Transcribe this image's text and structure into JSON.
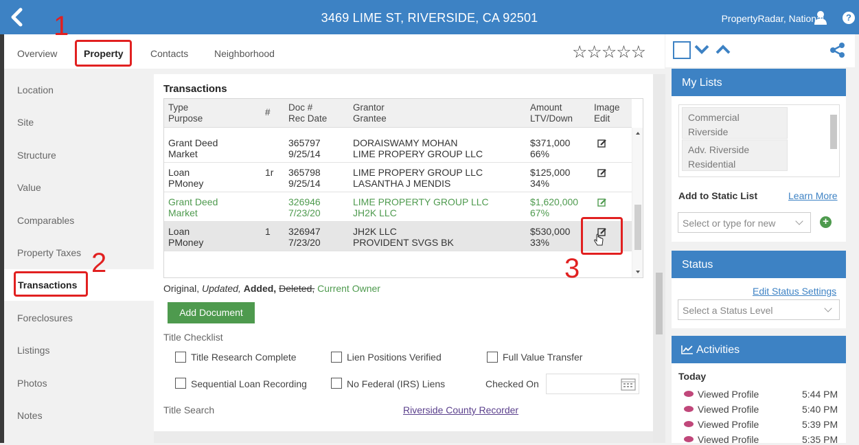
{
  "header": {
    "address": "3469 LIME ST, RIVERSIDE, CA 92501",
    "account": "PropertyRadar, National"
  },
  "tabs": [
    "Overview",
    "Property",
    "Contacts",
    "Neighborhood"
  ],
  "sidebar": {
    "items": [
      "Location",
      "Site",
      "Structure",
      "Value",
      "Comparables",
      "Property Taxes",
      "Transactions",
      "Foreclosures",
      "Listings",
      "Photos",
      "Notes"
    ]
  },
  "transactions": {
    "title": "Transactions",
    "columns": {
      "type": [
        "Type",
        "Purpose"
      ],
      "num": "#",
      "doc": [
        "Doc #",
        "Rec Date"
      ],
      "grantor": [
        "Grantor",
        "Grantee"
      ],
      "amount": [
        "Amount",
        "LTV/Down"
      ],
      "image": [
        "Image",
        "Edit"
      ]
    },
    "rows": [
      {
        "type": "Grant Deed",
        "purpose": "Market",
        "num": "",
        "doc": "365797",
        "date": "9/25/14",
        "grantor": "DORAISWAMY MOHAN",
        "grantee": "LIME PROPERY GROUP LLC",
        "amount": "$371,000",
        "ltv": "66%"
      },
      {
        "type": "Loan",
        "purpose": "PMoney",
        "num": "1r",
        "doc": "365798",
        "date": "9/25/14",
        "grantor": "LIME PROPERY GROUP LLC",
        "grantee": "LASANTHA J MENDIS",
        "amount": "$125,000",
        "ltv": "34%"
      },
      {
        "type": "Grant Deed",
        "purpose": "Market",
        "num": "",
        "doc": "326946",
        "date": "7/23/20",
        "grantor": "LIME PROPERTY GROUP LLC",
        "grantee": "JH2K LLC",
        "amount": "$1,620,000",
        "ltv": "67%"
      },
      {
        "type": "Loan",
        "purpose": "PMoney",
        "num": "1",
        "doc": "326947",
        "date": "7/23/20",
        "grantor": "JH2K LLC",
        "grantee": "PROVIDENT SVGS BK",
        "amount": "$530,000",
        "ltv": "33%"
      }
    ],
    "legend": {
      "original": "Original,",
      "updated": "Updated,",
      "added": "Added,",
      "deleted": "Deleted,",
      "current": "Current Owner"
    },
    "add_button": "Add Document"
  },
  "checklist": {
    "title": "Title Checklist",
    "items": [
      "Title Research Complete",
      "Lien Positions Verified",
      "Full Value Transfer",
      "Sequential Loan Recording",
      "No Federal (IRS) Liens"
    ],
    "checked_on_label": "Checked On",
    "title_search_label": "Title Search",
    "recorder_link": "Riverside County Recorder"
  },
  "my_lists": {
    "title": "My Lists",
    "items": [
      "Commercial Riverside",
      "Adv. Riverside Residential"
    ],
    "add_label": "Add to Static List",
    "learn_more": "Learn More",
    "select_placeholder": "Select or type for new"
  },
  "status": {
    "title": "Status",
    "edit_link": "Edit Status Settings",
    "select_placeholder": "Select a Status Level"
  },
  "activities": {
    "title": "Activities",
    "day": "Today",
    "items": [
      {
        "label": "Viewed Profile",
        "time": "5:44 PM"
      },
      {
        "label": "Viewed Profile",
        "time": "5:40 PM"
      },
      {
        "label": "Viewed Profile",
        "time": "5:39 PM"
      },
      {
        "label": "Viewed Profile",
        "time": "5:35 PM"
      }
    ]
  },
  "annotations": [
    "1",
    "2",
    "3"
  ],
  "colors": {
    "brand_blue": "#3d82c4",
    "green": "#4e9a4e",
    "annotation_red": "#e12020"
  }
}
